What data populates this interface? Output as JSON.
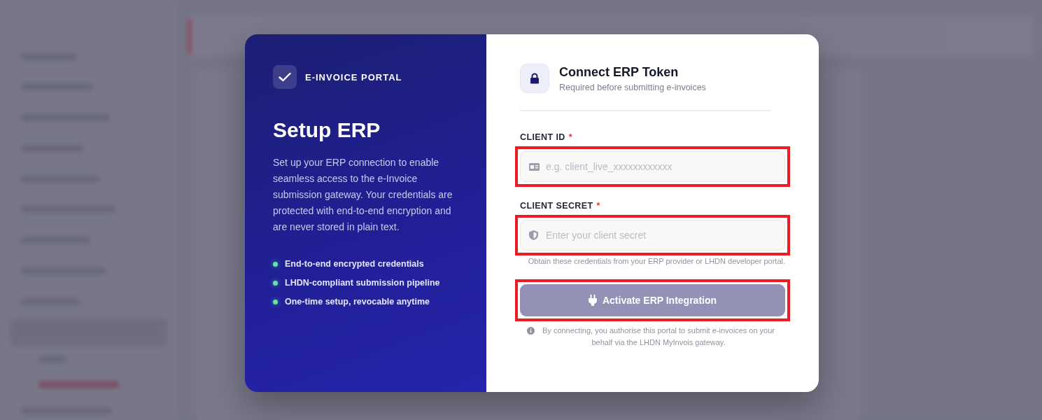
{
  "brand": {
    "label": "E-INVOICE PORTAL"
  },
  "intro": {
    "title": "Setup ERP",
    "text": "Set up your ERP connection to enable seamless access to the e-Invoice submission gateway. Your credentials are protected with end-to-end encryption and are never stored in plain text."
  },
  "features": [
    {
      "label": "End-to-end encrypted credentials",
      "color": "#5ee6a8"
    },
    {
      "label": "LHDN-compliant submission pipeline",
      "color": "#5ee6a8"
    },
    {
      "label": "One-time setup, revocable anytime",
      "color": "#5ee6a8"
    }
  ],
  "header": {
    "title": "Connect ERP Token",
    "subtitle": "Required before submitting e-invoices"
  },
  "fields": [
    {
      "kind": "id",
      "label": "CLIENT ID",
      "required_mark": "*",
      "placeholder": "e.g. client_live_xxxxxxxxxxxx",
      "highlighted": true
    },
    {
      "kind": "secret",
      "label": "CLIENT SECRET",
      "required_mark": "*",
      "placeholder": "Enter your client secret",
      "highlighted": true
    }
  ],
  "hint": "Obtain these credentials from your ERP provider or LHDN developer portal.",
  "submit": {
    "label": "Activate ERP Integration",
    "disabled": true,
    "highlighted": true
  },
  "notice": "By connecting, you authorise this portal to submit e-invoices on your behalf via the LHDN MyInvois gateway."
}
